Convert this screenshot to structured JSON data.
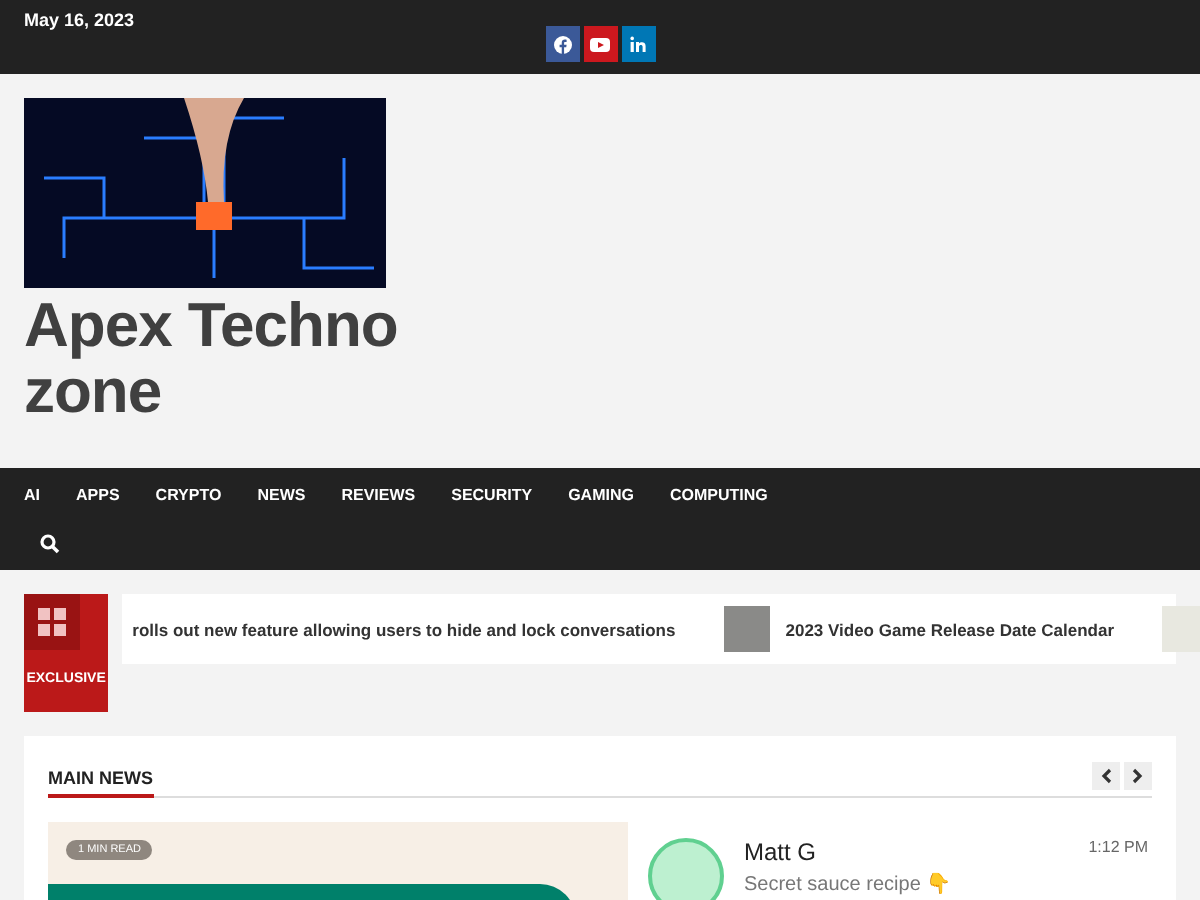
{
  "top_bar": {
    "date": "May 16, 2023",
    "social": [
      {
        "kind": "facebook",
        "color": "#3b5998"
      },
      {
        "kind": "youtube",
        "color": "#cc181e"
      },
      {
        "kind": "linkedin",
        "color": "#0077b5"
      }
    ]
  },
  "site": {
    "title": "Apex Techno zone"
  },
  "nav": {
    "items": [
      "AI",
      "APPS",
      "CRYPTO",
      "NEWS",
      "REVIEWS",
      "SECURITY",
      "GAMING",
      "COMPUTING"
    ]
  },
  "ticker": {
    "label": "EXCLUSIVE",
    "items": [
      "rolls out new feature allowing users to hide and lock conversations",
      "2023 Video Game Release Date Calendar"
    ]
  },
  "main_news": {
    "heading": "MAIN NEWS",
    "badge": "1 MIN READ",
    "chat": {
      "name": "Matt G",
      "time": "1:12 PM",
      "message": "Secret sauce recipe 👇"
    }
  }
}
